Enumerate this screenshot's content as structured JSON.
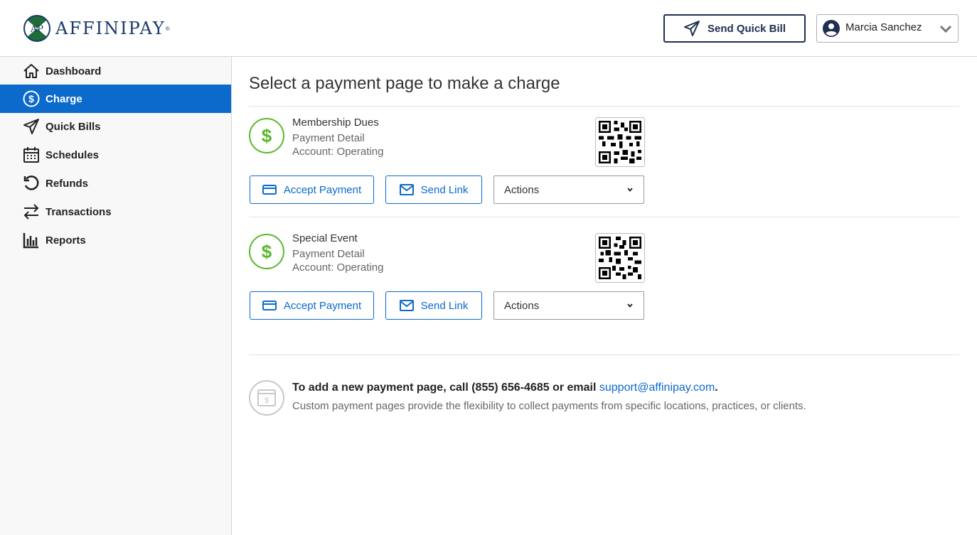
{
  "brand": {
    "name": "AFFINIPAY",
    "mark": "AP",
    "colors": {
      "navy": "#1a3a6b",
      "green": "#1f6b3a",
      "accent": "#0b6acb",
      "success": "#5ab82c"
    }
  },
  "header": {
    "quick_bill_label": "Send Quick Bill",
    "user_name": "Marcia Sanchez"
  },
  "sidebar": {
    "items": [
      {
        "label": "Dashboard",
        "icon": "home-icon"
      },
      {
        "label": "Charge",
        "icon": "dollar-circle-icon",
        "active": true
      },
      {
        "label": "Quick Bills",
        "icon": "paper-plane-icon"
      },
      {
        "label": "Schedules",
        "icon": "calendar-icon"
      },
      {
        "label": "Refunds",
        "icon": "refund-icon"
      },
      {
        "label": "Transactions",
        "icon": "transfer-arrows-icon"
      },
      {
        "label": "Reports",
        "icon": "bar-chart-icon"
      }
    ]
  },
  "main": {
    "title": "Select a payment page to make a charge",
    "pages": [
      {
        "name": "Membership Dues",
        "detail": "Payment Detail",
        "account": "Account: Operating",
        "accept_label": "Accept Payment",
        "send_label": "Send Link",
        "actions_label": "Actions"
      },
      {
        "name": "Special Event",
        "detail": "Payment Detail",
        "account": "Account: Operating",
        "accept_label": "Accept Payment",
        "send_label": "Send Link",
        "actions_label": "Actions"
      }
    ],
    "info": {
      "prefix": "To add a new payment page, call (855) 656-4685 or email ",
      "email": "support@affinipay.com",
      "suffix": ".",
      "description": "Custom payment pages provide the flexibility to collect payments from specific locations, practices, or clients."
    }
  }
}
